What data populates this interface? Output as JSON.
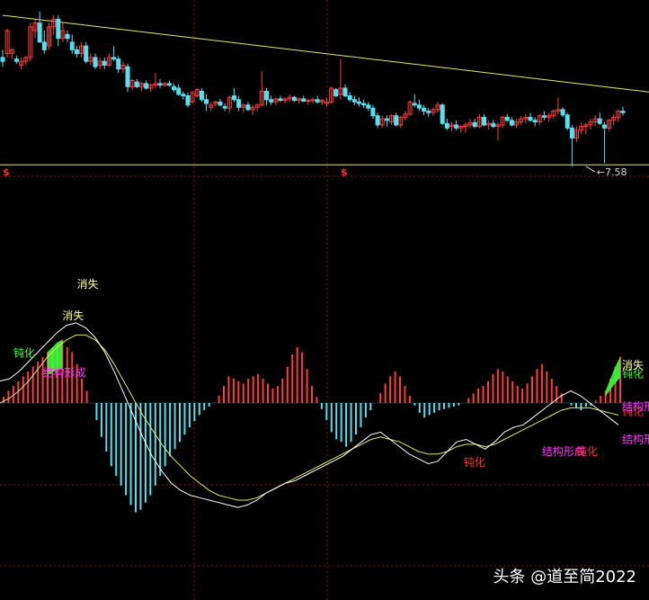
{
  "colors": {
    "background": "#000000",
    "up": "#ff3b3b",
    "down": "#54e0ee",
    "trendline": "#e8e86a",
    "grid": "#8a1010",
    "dif_line": "#ffffff",
    "dea_line": "#e6e66a",
    "label_yellow": "#ffffa0",
    "label_green": "#3cff3c",
    "label_magenta": "#ff36ff",
    "label_red": "#ff3030",
    "dollar": "#ff3030",
    "price_label": "#d8d8d8"
  },
  "watermark": "头条 @道至简2022",
  "chart_data": [
    {
      "type": "candlestick",
      "title": "",
      "low_marker": {
        "label": "7.58",
        "value": 7.58,
        "bar_index": 126
      },
      "dollar_markers": [
        {
          "label": "$",
          "bar_index": 0
        },
        {
          "label": "$",
          "bar_index": 73
        }
      ],
      "trendline": {
        "start": [
          0,
          9.55
        ],
        "end": [
          143,
          8.55
        ]
      },
      "support_line": 7.6,
      "ylim": [
        7.45,
        9.75
      ],
      "candles_ohlc": [
        [
          9.0,
          9.1,
          8.88,
          8.95
        ],
        [
          9.05,
          9.38,
          9.0,
          9.35
        ],
        [
          9.05,
          9.12,
          8.98,
          9.1
        ],
        [
          8.98,
          9.02,
          8.92,
          8.95
        ],
        [
          8.9,
          9.0,
          8.85,
          8.95
        ],
        [
          8.95,
          9.02,
          8.9,
          9.0
        ],
        [
          9.0,
          9.45,
          8.95,
          9.4
        ],
        [
          9.35,
          9.5,
          9.25,
          9.45
        ],
        [
          9.45,
          9.6,
          9.3,
          9.2
        ],
        [
          9.2,
          9.35,
          9.05,
          9.1
        ],
        [
          9.15,
          9.45,
          9.1,
          9.4
        ],
        [
          9.4,
          9.55,
          9.3,
          9.5
        ],
        [
          9.5,
          9.55,
          9.15,
          9.25
        ],
        [
          9.25,
          9.45,
          9.2,
          9.35
        ],
        [
          9.3,
          9.35,
          9.2,
          9.25
        ],
        [
          9.2,
          9.3,
          9.05,
          9.1
        ],
        [
          9.1,
          9.15,
          9.0,
          9.05
        ],
        [
          9.05,
          9.2,
          9.0,
          9.15
        ],
        [
          9.15,
          9.2,
          8.92,
          8.95
        ],
        [
          8.95,
          9.05,
          8.9,
          9.0
        ],
        [
          9.0,
          9.05,
          8.85,
          8.88
        ],
        [
          8.9,
          9.0,
          8.85,
          8.95
        ],
        [
          8.95,
          9.0,
          8.85,
          8.9
        ],
        [
          8.9,
          9.05,
          8.88,
          9.0
        ],
        [
          9.0,
          9.15,
          8.95,
          8.98
        ],
        [
          8.98,
          9.02,
          8.8,
          8.85
        ],
        [
          8.85,
          8.95,
          8.8,
          8.9
        ],
        [
          8.88,
          8.92,
          8.55,
          8.62
        ],
        [
          8.62,
          8.72,
          8.58,
          8.7
        ],
        [
          8.68,
          8.72,
          8.6,
          8.62
        ],
        [
          8.62,
          8.68,
          8.56,
          8.66
        ],
        [
          8.66,
          8.7,
          8.58,
          8.6
        ],
        [
          8.6,
          8.66,
          8.55,
          8.64
        ],
        [
          8.64,
          8.8,
          8.6,
          8.66
        ],
        [
          8.66,
          8.72,
          8.6,
          8.64
        ],
        [
          8.64,
          8.68,
          8.62,
          8.66
        ],
        [
          8.66,
          8.7,
          8.62,
          8.64
        ],
        [
          8.62,
          8.66,
          8.55,
          8.58
        ],
        [
          8.6,
          8.65,
          8.5,
          8.52
        ],
        [
          8.52,
          8.56,
          8.45,
          8.5
        ],
        [
          8.5,
          8.54,
          8.35,
          8.38
        ],
        [
          8.42,
          8.56,
          8.4,
          8.54
        ],
        [
          8.5,
          8.6,
          8.48,
          8.58
        ],
        [
          8.56,
          8.6,
          8.42,
          8.45
        ],
        [
          8.45,
          8.52,
          8.3,
          8.4
        ],
        [
          8.35,
          8.42,
          8.3,
          8.38
        ],
        [
          8.4,
          8.44,
          8.36,
          8.42
        ],
        [
          8.42,
          8.46,
          8.36,
          8.38
        ],
        [
          8.36,
          8.4,
          8.3,
          8.34
        ],
        [
          8.34,
          8.5,
          8.28,
          8.48
        ],
        [
          8.5,
          8.6,
          8.42,
          8.45
        ],
        [
          8.45,
          8.5,
          8.3,
          8.35
        ],
        [
          8.35,
          8.4,
          8.28,
          8.38
        ],
        [
          8.38,
          8.42,
          8.3,
          8.32
        ],
        [
          8.32,
          8.38,
          8.25,
          8.35
        ],
        [
          8.35,
          8.4,
          8.3,
          8.38
        ],
        [
          8.38,
          8.82,
          8.36,
          8.56
        ],
        [
          8.56,
          8.6,
          8.38,
          8.45
        ],
        [
          8.45,
          8.5,
          8.38,
          8.42
        ],
        [
          8.42,
          8.48,
          8.38,
          8.46
        ],
        [
          8.46,
          8.5,
          8.42,
          8.44
        ],
        [
          8.44,
          8.48,
          8.4,
          8.46
        ],
        [
          8.46,
          8.52,
          8.42,
          8.48
        ],
        [
          8.48,
          8.5,
          8.42,
          8.44
        ],
        [
          8.44,
          8.48,
          8.4,
          8.46
        ],
        [
          8.46,
          8.5,
          8.42,
          8.43
        ],
        [
          8.43,
          8.46,
          8.38,
          8.44
        ],
        [
          8.44,
          8.48,
          8.4,
          8.45
        ],
        [
          8.45,
          8.5,
          8.4,
          8.42
        ],
        [
          8.42,
          8.46,
          8.38,
          8.44
        ],
        [
          8.4,
          8.48,
          8.36,
          8.42
        ],
        [
          8.42,
          8.62,
          8.4,
          8.6
        ],
        [
          8.58,
          8.6,
          8.48,
          8.5
        ],
        [
          8.52,
          8.98,
          8.45,
          8.6
        ],
        [
          8.6,
          8.65,
          8.48,
          8.5
        ],
        [
          8.5,
          8.55,
          8.42,
          8.45
        ],
        [
          8.45,
          8.5,
          8.38,
          8.42
        ],
        [
          8.42,
          8.48,
          8.36,
          8.4
        ],
        [
          8.4,
          8.45,
          8.34,
          8.38
        ],
        [
          8.38,
          8.42,
          8.3,
          8.34
        ],
        [
          8.34,
          8.38,
          8.2,
          8.24
        ],
        [
          8.24,
          8.28,
          8.08,
          8.12
        ],
        [
          8.12,
          8.24,
          8.08,
          8.2
        ],
        [
          8.2,
          8.25,
          8.1,
          8.18
        ],
        [
          8.16,
          8.26,
          8.12,
          8.24
        ],
        [
          8.24,
          8.28,
          8.1,
          8.12
        ],
        [
          8.12,
          8.24,
          8.08,
          8.22
        ],
        [
          8.22,
          8.3,
          8.18,
          8.26
        ],
        [
          8.26,
          8.44,
          8.24,
          8.42
        ],
        [
          8.4,
          8.52,
          8.35,
          8.38
        ],
        [
          8.38,
          8.45,
          8.3,
          8.34
        ],
        [
          8.34,
          8.38,
          8.25,
          8.3
        ],
        [
          8.3,
          8.34,
          8.22,
          8.28
        ],
        [
          8.28,
          8.35,
          8.24,
          8.32
        ],
        [
          8.32,
          8.42,
          8.28,
          8.38
        ],
        [
          8.38,
          8.4,
          8.12,
          8.14
        ],
        [
          8.14,
          8.2,
          8.05,
          8.08
        ],
        [
          8.1,
          8.16,
          8.04,
          8.12
        ],
        [
          8.12,
          8.18,
          8.05,
          8.08
        ],
        [
          8.08,
          8.12,
          8.02,
          8.1
        ],
        [
          8.1,
          8.16,
          8.02,
          8.12
        ],
        [
          8.12,
          8.2,
          8.08,
          8.15
        ],
        [
          8.15,
          8.2,
          8.08,
          8.1
        ],
        [
          8.1,
          8.26,
          8.08,
          8.22
        ],
        [
          8.22,
          8.26,
          8.1,
          8.12
        ],
        [
          8.12,
          8.18,
          8.06,
          8.14
        ],
        [
          8.14,
          8.18,
          8.08,
          8.1
        ],
        [
          8.1,
          8.15,
          7.92,
          8.12
        ],
        [
          8.12,
          8.24,
          8.08,
          8.22
        ],
        [
          8.22,
          8.26,
          8.16,
          8.18
        ],
        [
          8.18,
          8.22,
          8.1,
          8.12
        ],
        [
          8.12,
          8.2,
          8.08,
          8.16
        ],
        [
          8.16,
          8.24,
          8.12,
          8.2
        ],
        [
          8.2,
          8.26,
          8.14,
          8.22
        ],
        [
          8.22,
          8.28,
          8.16,
          8.18
        ],
        [
          8.18,
          8.22,
          8.1,
          8.16
        ],
        [
          8.16,
          8.26,
          8.12,
          8.24
        ],
        [
          8.24,
          8.3,
          8.18,
          8.22
        ],
        [
          8.22,
          8.28,
          8.16,
          8.24
        ],
        [
          8.24,
          8.32,
          8.2,
          8.3
        ],
        [
          8.3,
          8.48,
          8.26,
          8.32
        ],
        [
          8.32,
          8.35,
          8.22,
          8.25
        ],
        [
          8.25,
          8.28,
          8.05,
          8.08
        ],
        [
          8.08,
          8.12,
          7.58,
          7.95
        ],
        [
          7.95,
          8.1,
          7.9,
          8.05
        ],
        [
          8.05,
          8.15,
          8.0,
          8.1
        ],
        [
          8.1,
          8.15,
          8.0,
          8.12
        ],
        [
          8.12,
          8.2,
          8.06,
          8.16
        ],
        [
          8.16,
          8.25,
          8.1,
          8.2
        ],
        [
          8.2,
          8.28,
          8.12,
          8.14
        ],
        [
          8.12,
          8.16,
          7.62,
          8.08
        ],
        [
          8.08,
          8.2,
          8.04,
          8.18
        ],
        [
          8.18,
          8.26,
          8.12,
          8.22
        ],
        [
          8.22,
          8.32,
          8.16,
          8.3
        ],
        [
          8.3,
          8.36,
          8.24,
          8.28
        ]
      ]
    },
    {
      "type": "bar",
      "title": "",
      "zero_axis": true,
      "ylim": [
        -1.0,
        0.75
      ],
      "histogram": [
        0.05,
        0.1,
        0.14,
        0.18,
        0.22,
        0.26,
        0.3,
        0.34,
        0.38,
        0.42,
        0.46,
        0.5,
        0.52,
        0.46,
        0.42,
        0.32,
        0.2,
        0.1,
        0.0,
        -0.14,
        -0.28,
        -0.4,
        -0.52,
        -0.6,
        -0.68,
        -0.76,
        -0.84,
        -0.9,
        -0.88,
        -0.82,
        -0.76,
        -0.68,
        -0.6,
        -0.52,
        -0.44,
        -0.38,
        -0.32,
        -0.26,
        -0.2,
        -0.15,
        -0.1,
        -0.06,
        -0.03,
        0.0,
        0.06,
        0.14,
        0.22,
        0.2,
        0.18,
        0.16,
        0.2,
        0.22,
        0.24,
        0.2,
        0.16,
        0.12,
        0.14,
        0.2,
        0.3,
        0.4,
        0.46,
        0.42,
        0.28,
        0.14,
        0.05,
        -0.05,
        -0.14,
        -0.24,
        -0.3,
        -0.32,
        -0.36,
        -0.32,
        -0.26,
        -0.2,
        -0.12,
        -0.06,
        0.0,
        0.08,
        0.16,
        0.22,
        0.26,
        0.22,
        0.14,
        0.06,
        -0.02,
        -0.08,
        -0.12,
        -0.1,
        -0.08,
        -0.06,
        -0.05,
        -0.04,
        -0.03,
        -0.02,
        0.0,
        0.04,
        0.08,
        0.12,
        0.14,
        0.18,
        0.24,
        0.28,
        0.26,
        0.22,
        0.18,
        0.14,
        0.12,
        0.16,
        0.22,
        0.28,
        0.32,
        0.26,
        0.2,
        0.14,
        0.08,
        0.0,
        -0.02,
        -0.04,
        -0.06,
        -0.03,
        -0.02,
        0.02,
        0.06,
        0.1,
        0.2,
        0.3,
        0.38
      ],
      "dif": [
        0.18,
        0.2,
        0.26,
        0.34,
        0.42,
        0.5,
        0.58,
        0.64,
        0.66,
        0.62,
        0.54,
        0.42,
        0.26,
        0.08,
        -0.1,
        -0.28,
        -0.44,
        -0.56,
        -0.66,
        -0.72,
        -0.76,
        -0.78,
        -0.8,
        -0.82,
        -0.84,
        -0.86,
        -0.84,
        -0.8,
        -0.74,
        -0.7,
        -0.66,
        -0.64,
        -0.6,
        -0.56,
        -0.52,
        -0.48,
        -0.44,
        -0.38,
        -0.32,
        -0.26,
        -0.24,
        -0.3,
        -0.36,
        -0.42,
        -0.46,
        -0.5,
        -0.48,
        -0.4,
        -0.32,
        -0.3,
        -0.34,
        -0.38,
        -0.32,
        -0.24,
        -0.2,
        -0.18,
        -0.12,
        -0.06,
        0.0,
        0.06,
        0.1,
        0.06,
        0.0,
        -0.06,
        -0.12,
        -0.18
      ],
      "dea": [
        0.0,
        0.04,
        0.1,
        0.18,
        0.28,
        0.38,
        0.46,
        0.52,
        0.56,
        0.56,
        0.52,
        0.44,
        0.32,
        0.18,
        0.04,
        -0.1,
        -0.22,
        -0.34,
        -0.44,
        -0.52,
        -0.6,
        -0.66,
        -0.72,
        -0.76,
        -0.78,
        -0.8,
        -0.8,
        -0.78,
        -0.74,
        -0.7,
        -0.66,
        -0.62,
        -0.58,
        -0.54,
        -0.5,
        -0.46,
        -0.42,
        -0.38,
        -0.34,
        -0.3,
        -0.28,
        -0.3,
        -0.32,
        -0.36,
        -0.4,
        -0.42,
        -0.42,
        -0.4,
        -0.36,
        -0.34,
        -0.34,
        -0.36,
        -0.34,
        -0.3,
        -0.26,
        -0.22,
        -0.18,
        -0.14,
        -0.1,
        -0.06,
        -0.04,
        -0.04,
        -0.04,
        -0.06,
        -0.08,
        -0.1
      ]
    }
  ],
  "annotations": [
    {
      "id": "xiaoshi-top",
      "text": "消失",
      "color_key": "label_yellow",
      "bar": 15,
      "level": 0.95
    },
    {
      "id": "xiaoshi-upper",
      "text": "消失",
      "color_key": "label_yellow",
      "bar": 12,
      "level": 0.69
    },
    {
      "id": "dunhua-left",
      "text": "钝化",
      "color_key": "label_green",
      "bar": 2,
      "level": 0.38
    },
    {
      "id": "jiegou-left",
      "text": "结构形成",
      "color_key": "label_magenta",
      "bar": 8,
      "level": 0.22
    },
    {
      "id": "dunhua-mid1",
      "text": "钝化",
      "color_key": "label_red",
      "bar": 94,
      "level": -0.52
    },
    {
      "id": "jiegou-mid1",
      "text": "结构形成",
      "color_key": "label_magenta",
      "bar": 110,
      "level": -0.43
    },
    {
      "id": "dunhua-mid2",
      "text": "钝化",
      "color_key": "label_red",
      "bar": 117,
      "level": -0.43
    },
    {
      "id": "jiegou-mid2",
      "text": "结构形成",
      "color_key": "label_magenta",
      "bar": 128,
      "level": -0.33
    },
    {
      "id": "dunhua-right",
      "text": "钝化",
      "color_key": "label_red",
      "bar": 145,
      "level": -0.1
    },
    {
      "id": "jiegou-right",
      "text": "结构形成",
      "color_key": "label_magenta",
      "bar": 153,
      "level": -0.06
    },
    {
      "id": "dunhua-far-right",
      "text": "钝化",
      "color_key": "label_green",
      "bar": 156,
      "level": 0.21
    },
    {
      "id": "xiaoshi-right",
      "text": "消失",
      "color_key": "label_yellow",
      "bar": 158,
      "level": 0.28
    }
  ]
}
